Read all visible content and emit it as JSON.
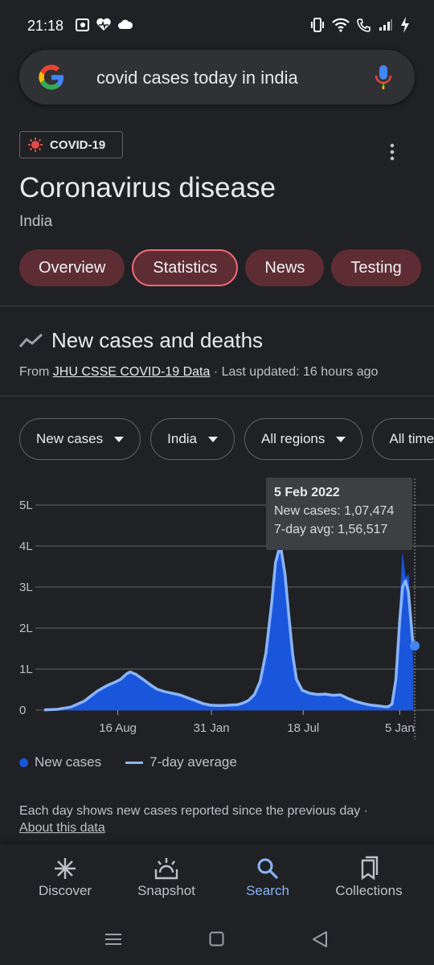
{
  "status_bar": {
    "time": "21:18"
  },
  "search": {
    "query": "covid cases today in india"
  },
  "card": {
    "chip_label": "COVID-19",
    "title": "Coronavirus disease",
    "subtitle": "India",
    "tabs": [
      {
        "label": "Overview"
      },
      {
        "label": "Statistics"
      },
      {
        "label": "News"
      },
      {
        "label": "Testing"
      }
    ]
  },
  "section": {
    "title": "New cases and deaths",
    "source_prefix": "From ",
    "source_link": "JHU CSSE COVID-19 Data",
    "source_suffix": " · Last updated: 16 hours ago"
  },
  "filters": [
    {
      "label": "New cases"
    },
    {
      "label": "India"
    },
    {
      "label": "All regions"
    },
    {
      "label": "All time"
    }
  ],
  "tooltip": {
    "date": "5 Feb 2022",
    "new_cases": "New cases: 1,07,474",
    "avg": "7-day avg: 1,56,517"
  },
  "legend": {
    "new_cases": "New cases",
    "avg": "7-day average"
  },
  "note": {
    "text": "Each day shows new cases reported since the previous day",
    "sep": " · ",
    "link": "About this data"
  },
  "bottom_nav": [
    {
      "label": "Discover"
    },
    {
      "label": "Snapshot"
    },
    {
      "label": "Search"
    },
    {
      "label": "Collections"
    }
  ],
  "colors": {
    "accent": "#8ab4f8",
    "bar": "#1a56db",
    "tab_bg": "#5e2d34",
    "tab_border": "#ee6877"
  },
  "chart_data": {
    "type": "area",
    "ylabel_ticks": [
      "0",
      "1L",
      "2L",
      "3L",
      "4L",
      "5L"
    ],
    "ylim": [
      0,
      500000
    ],
    "x_ticks": [
      "16 Aug",
      "31 Jan",
      "18 Jul",
      "5 Jan"
    ],
    "series": [
      {
        "name": "New cases",
        "points": [
          [
            0,
            500
          ],
          [
            14,
            2000
          ],
          [
            28,
            8000
          ],
          [
            42,
            25000
          ],
          [
            56,
            50000
          ],
          [
            66,
            62000
          ],
          [
            74,
            70000
          ],
          [
            80,
            78000
          ],
          [
            86,
            90000
          ],
          [
            90,
            95000
          ],
          [
            96,
            88000
          ],
          [
            104,
            75000
          ],
          [
            112,
            60000
          ],
          [
            118,
            50000
          ],
          [
            126,
            45000
          ],
          [
            134,
            42000
          ],
          [
            142,
            38000
          ],
          [
            150,
            30000
          ],
          [
            158,
            22000
          ],
          [
            166,
            15000
          ],
          [
            174,
            12000
          ],
          [
            182,
            11000
          ],
          [
            190,
            12000
          ],
          [
            196,
            15000
          ],
          [
            202,
            12000
          ],
          [
            208,
            18000
          ],
          [
            214,
            25000
          ],
          [
            220,
            40000
          ],
          [
            226,
            75000
          ],
          [
            232,
            150000
          ],
          [
            238,
            280000
          ],
          [
            242,
            370000
          ],
          [
            246,
            410000
          ],
          [
            248,
            400000
          ],
          [
            252,
            340000
          ],
          [
            256,
            230000
          ],
          [
            260,
            130000
          ],
          [
            264,
            70000
          ],
          [
            270,
            45000
          ],
          [
            278,
            40000
          ],
          [
            286,
            38000
          ],
          [
            294,
            42000
          ],
          [
            302,
            35000
          ],
          [
            310,
            40000
          ],
          [
            318,
            28000
          ],
          [
            326,
            20000
          ],
          [
            334,
            15000
          ],
          [
            342,
            12000
          ],
          [
            350,
            10000
          ],
          [
            356,
            8000
          ],
          [
            360,
            7000
          ],
          [
            364,
            12000
          ],
          [
            368,
            80000
          ],
          [
            372,
            250000
          ],
          [
            375,
            380000
          ],
          [
            378,
            320000
          ],
          [
            381,
            330000
          ],
          [
            384,
            200000
          ],
          [
            386,
            107474
          ]
        ]
      },
      {
        "name": "7-day average",
        "points": [
          [
            0,
            500
          ],
          [
            14,
            2000
          ],
          [
            28,
            7500
          ],
          [
            42,
            22000
          ],
          [
            56,
            47000
          ],
          [
            66,
            60000
          ],
          [
            74,
            68000
          ],
          [
            80,
            75000
          ],
          [
            86,
            88000
          ],
          [
            90,
            93000
          ],
          [
            96,
            87000
          ],
          [
            104,
            74000
          ],
          [
            112,
            60000
          ],
          [
            118,
            51000
          ],
          [
            126,
            45000
          ],
          [
            134,
            41000
          ],
          [
            142,
            37000
          ],
          [
            150,
            30000
          ],
          [
            158,
            23000
          ],
          [
            166,
            16000
          ],
          [
            174,
            12000
          ],
          [
            182,
            11000
          ],
          [
            190,
            11500
          ],
          [
            196,
            12500
          ],
          [
            202,
            13000
          ],
          [
            208,
            17000
          ],
          [
            214,
            24000
          ],
          [
            220,
            38000
          ],
          [
            226,
            70000
          ],
          [
            232,
            140000
          ],
          [
            238,
            260000
          ],
          [
            242,
            360000
          ],
          [
            246,
            392000
          ],
          [
            248,
            390000
          ],
          [
            252,
            330000
          ],
          [
            256,
            230000
          ],
          [
            260,
            135000
          ],
          [
            264,
            75000
          ],
          [
            270,
            48000
          ],
          [
            278,
            41000
          ],
          [
            286,
            38000
          ],
          [
            294,
            39000
          ],
          [
            302,
            36000
          ],
          [
            310,
            37000
          ],
          [
            318,
            28000
          ],
          [
            326,
            21000
          ],
          [
            334,
            16000
          ],
          [
            342,
            12000
          ],
          [
            350,
            10000
          ],
          [
            356,
            8500
          ],
          [
            360,
            8000
          ],
          [
            364,
            15000
          ],
          [
            368,
            75000
          ],
          [
            372,
            220000
          ],
          [
            375,
            300000
          ],
          [
            378,
            315000
          ],
          [
            381,
            290000
          ],
          [
            384,
            210000
          ],
          [
            386,
            156517
          ]
        ]
      }
    ],
    "x_tick_positions_day_index": [
      77,
      175,
      271,
      372
    ],
    "grid": true
  }
}
